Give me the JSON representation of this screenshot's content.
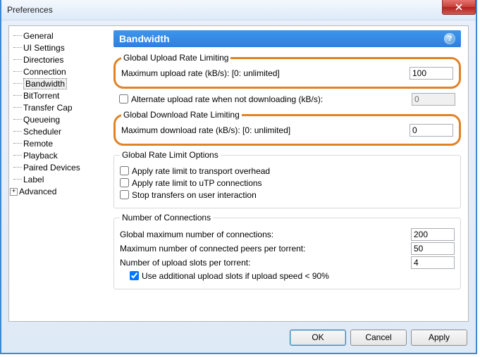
{
  "window": {
    "title": "Preferences"
  },
  "sidebar": {
    "items": [
      {
        "label": "General"
      },
      {
        "label": "UI Settings"
      },
      {
        "label": "Directories"
      },
      {
        "label": "Connection"
      },
      {
        "label": "Bandwidth",
        "selected": true
      },
      {
        "label": "BitTorrent"
      },
      {
        "label": "Transfer Cap"
      },
      {
        "label": "Queueing"
      },
      {
        "label": "Scheduler"
      },
      {
        "label": "Remote"
      },
      {
        "label": "Playback"
      },
      {
        "label": "Paired Devices"
      },
      {
        "label": "Label"
      },
      {
        "label": "Advanced",
        "expandable": true
      }
    ]
  },
  "panel": {
    "title": "Bandwidth",
    "help": "?"
  },
  "upload": {
    "legend": "Global Upload Rate Limiting",
    "max_label": "Maximum upload rate (kB/s): [0: unlimited]",
    "max_value": "100",
    "alt_label": "Alternate upload rate when not downloading (kB/s):",
    "alt_value": "0"
  },
  "download": {
    "legend": "Global Download Rate Limiting",
    "max_label": "Maximum download rate (kB/s): [0: unlimited]",
    "max_value": "0"
  },
  "options": {
    "legend": "Global Rate Limit Options",
    "opt1": "Apply rate limit to transport overhead",
    "opt2": "Apply rate limit to uTP connections",
    "opt3": "Stop transfers on user interaction"
  },
  "connections": {
    "legend": "Number of Connections",
    "global_label": "Global maximum number of connections:",
    "global_value": "200",
    "peers_label": "Maximum number of connected peers per torrent:",
    "peers_value": "50",
    "slots_label": "Number of upload slots per torrent:",
    "slots_value": "4",
    "extra_label": "Use additional upload slots if upload speed < 90%"
  },
  "buttons": {
    "ok": "OK",
    "cancel": "Cancel",
    "apply": "Apply"
  }
}
